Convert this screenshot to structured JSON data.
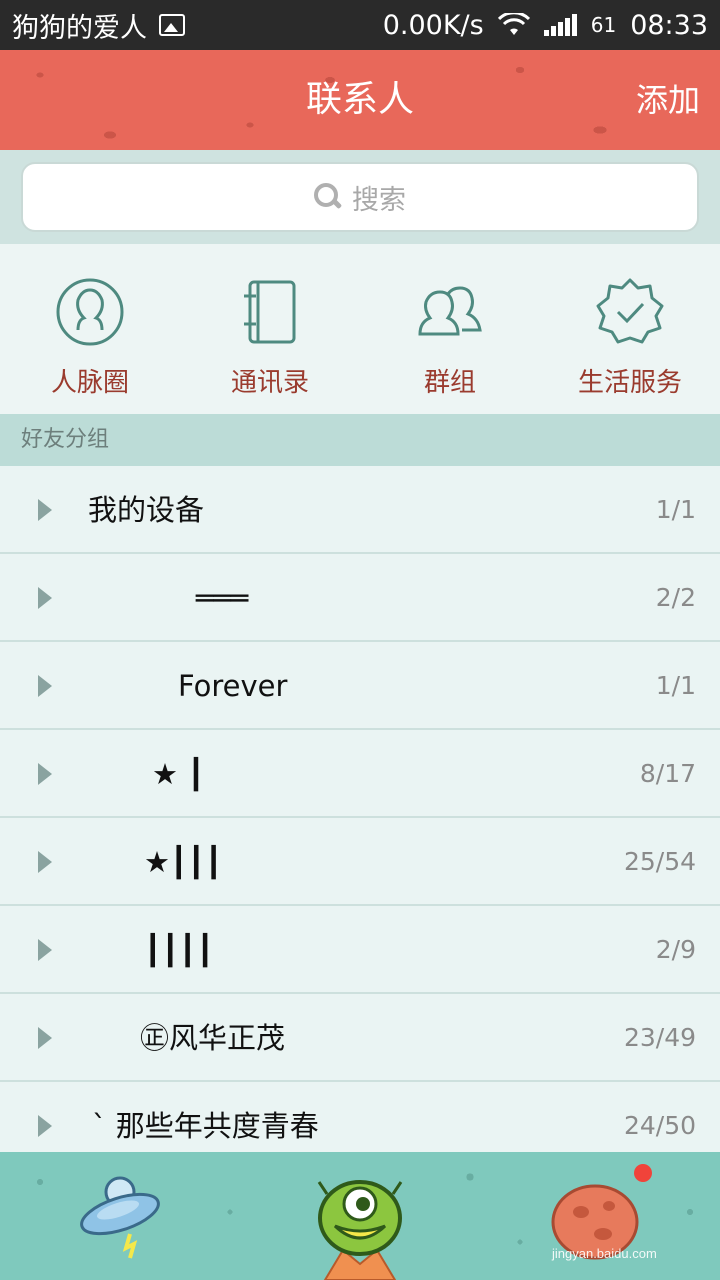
{
  "status_bar": {
    "notification_text": "狗狗的爱人",
    "net_speed": "0.00K/s",
    "battery": "61",
    "time": "08:33"
  },
  "header": {
    "title": "联系人",
    "add_label": "添加"
  },
  "search": {
    "placeholder": "搜索"
  },
  "quick_entries": [
    {
      "label": "人脉圈",
      "icon": "person-circle-icon"
    },
    {
      "label": "通讯录",
      "icon": "address-book-icon"
    },
    {
      "label": "群组",
      "icon": "group-people-icon"
    },
    {
      "label": "生活服务",
      "icon": "badge-check-icon"
    }
  ],
  "section": {
    "title": "好友分组"
  },
  "groups": [
    {
      "name": "我的设备",
      "count": "1/1"
    },
    {
      "name": "═══",
      "count": "2/2"
    },
    {
      "name": "Forever",
      "count": "1/1"
    },
    {
      "name": "★ ┃",
      "count": "8/17"
    },
    {
      "name": "★┃┃┃",
      "count": "25/54"
    },
    {
      "name": "┃┃┃┃",
      "count": "2/9"
    },
    {
      "name": "㊣风华正茂",
      "count": "23/49"
    },
    {
      "name": "ˋ 那些年共度青春",
      "count": "24/50"
    }
  ],
  "bottom_tabs": [
    {
      "icon": "ufo-icon"
    },
    {
      "icon": "alien-icon"
    },
    {
      "icon": "planet-icon"
    }
  ],
  "watermark": "jingyan.baidu.com",
  "colors": {
    "header": "#e8685a",
    "quick_label": "#9a3b2e",
    "section": "#bcdcd7",
    "bottom_bar": "#7fc9bd",
    "badge": "#f0433a"
  }
}
